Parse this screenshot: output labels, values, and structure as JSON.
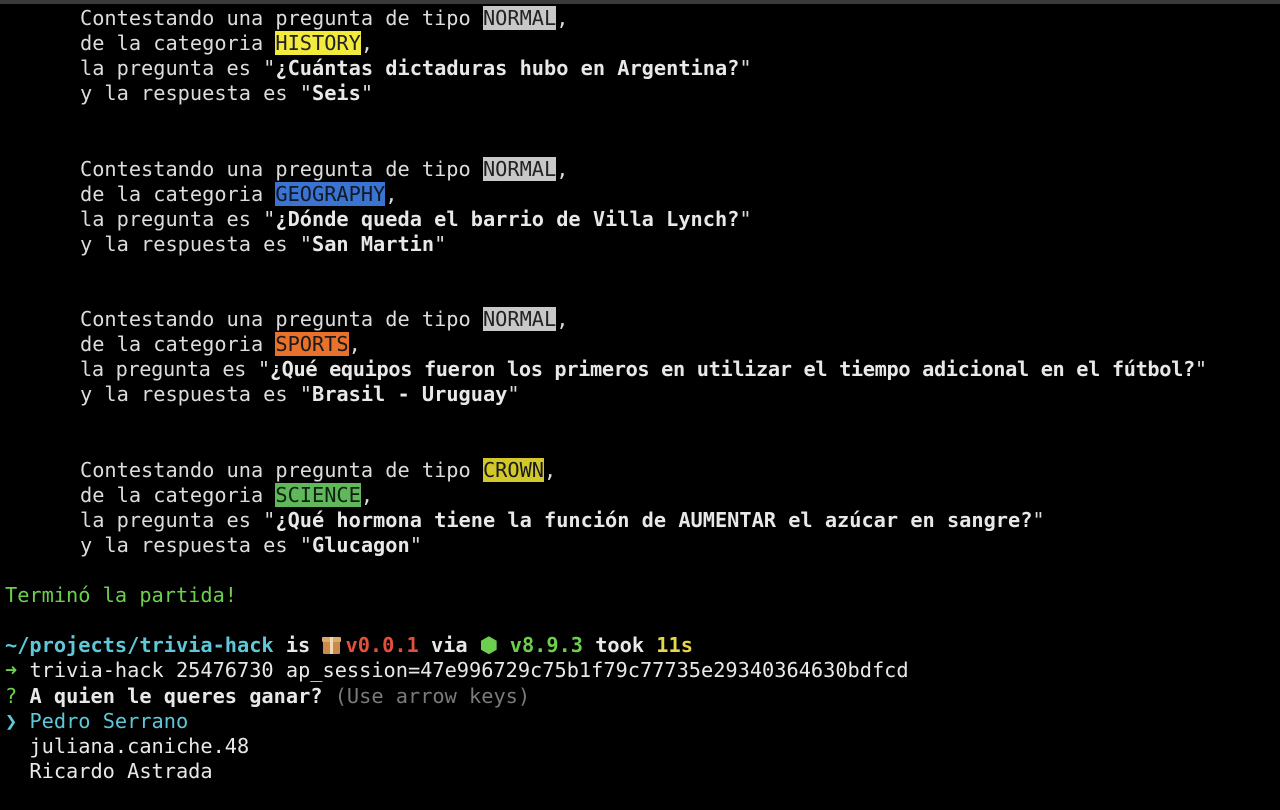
{
  "colors": {
    "background": "#000000",
    "text": "#dcdcdc",
    "type_normal_bg": "#c8c8c8",
    "history_bg": "#f2ea3c",
    "geography_bg": "#3b74d0",
    "sports_bg": "#e8722c",
    "crown_bg": "#d2c82a",
    "science_bg": "#5fb85a",
    "success_green": "#6ccf4e",
    "path_cyan": "#5fc8d8",
    "version_red": "#e0503c",
    "took_yellow": "#e8d64a"
  },
  "answers": [
    {
      "prefix_type": "Contestando una pregunta de tipo ",
      "type": "NORMAL",
      "prefix_category": "de la categoria ",
      "category": "HISTORY",
      "question_prefix": "la pregunta es \"",
      "question": "¿Cuántas dictaduras hubo en Argentina?",
      "answer_prefix": "y la respuesta es \"",
      "answer": "Seis"
    },
    {
      "prefix_type": "Contestando una pregunta de tipo ",
      "type": "NORMAL",
      "prefix_category": "de la categoria ",
      "category": "GEOGRAPHY",
      "question_prefix": "la pregunta es \"",
      "question": "¿Dónde queda el barrio de Villa Lynch?",
      "answer_prefix": "y la respuesta es \"",
      "answer": "San Martin"
    },
    {
      "prefix_type": "Contestando una pregunta de tipo ",
      "type": "NORMAL",
      "prefix_category": "de la categoria ",
      "category": "SPORTS",
      "question_prefix": "la pregunta es \"",
      "question": "¿Qué equipos fueron los primeros en utilizar el tiempo adicional en el fútbol?",
      "answer_prefix": "y la respuesta es \"",
      "answer": "Brasil - Uruguay"
    },
    {
      "prefix_type": "Contestando una pregunta de tipo ",
      "type": "CROWN",
      "prefix_category": "de la categoria ",
      "category": "SCIENCE",
      "question_prefix": "la pregunta es \"",
      "question": "¿Qué hormona tiene la función de AUMENTAR el azúcar en sangre?",
      "answer_prefix": "y la respuesta es \"",
      "answer": "Glucagon"
    }
  ],
  "game_over": "Terminó la partida!",
  "prompt": {
    "path": "~/projects/trivia-hack",
    "is": " is ",
    "package_icon": "package-icon",
    "version": "v0.0.1",
    "via": " via ",
    "node_icon": "node-hexagon-icon",
    "node_version": "v8.9.3",
    "took": " took ",
    "duration": "11s"
  },
  "command": {
    "arrow_icon": "arrow-right-icon",
    "text": "trivia-hack 25476730 ap_session=47e996729c75b1f79c77735e29340364630bdfcd"
  },
  "question_prompt": {
    "mark": "?",
    "text": "A quien le queres ganar?",
    "hint": "(Use arrow keys)"
  },
  "options": {
    "pointer": "❯",
    "items": [
      "Pedro Serrano",
      "juliana.caniche.48",
      "Ricardo Astrada"
    ],
    "selected_index": 0
  }
}
